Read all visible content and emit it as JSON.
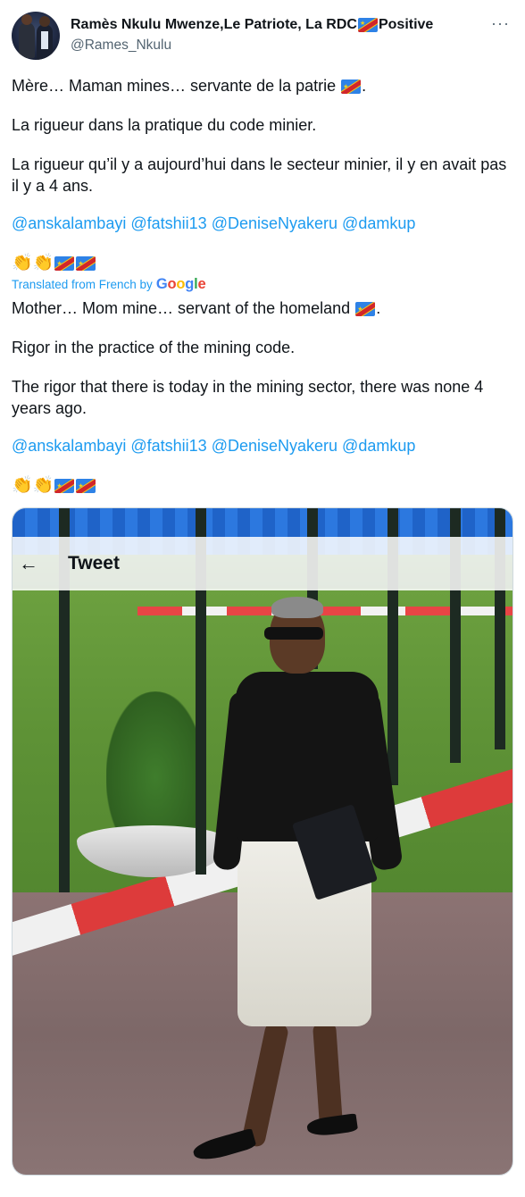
{
  "author": {
    "display_name": "Ramès Nkulu Mwenze,Le Patriote, La RDC",
    "display_name_suffix": "Positive",
    "handle": "@Rames_Nkulu"
  },
  "more_menu": "···",
  "original": {
    "line1": "Mère… Maman mines… servante de la patrie",
    "line1_end": ".",
    "line2": "La rigueur dans la pratique du code minier.",
    "line3": "La rigueur qu’il y a aujourd’hui dans le secteur minier, il y en avait pas il y a 4 ans.",
    "mentions": [
      "@anskalambayi",
      "@fatshii13",
      "@DeniseNyakeru",
      "@damkup"
    ]
  },
  "translation_label": "Translated from French by",
  "google_letters": [
    "G",
    "o",
    "o",
    "g",
    "l",
    "e"
  ],
  "translated": {
    "line1": "Mother… Mom mine… servant of the homeland",
    "line1_end": ".",
    "line2": "Rigor in the practice of the mining code.",
    "line3": "The rigor that there is today in the mining sector, there was none 4 years ago.",
    "mentions": [
      "@anskalambayi",
      "@fatshii13",
      "@DeniseNyakeru",
      "@damkup"
    ]
  },
  "emoji_row": {
    "clap": "👏",
    "flag_icon": "drc-flag-icon"
  },
  "media_screenshot": {
    "back_arrow": "←",
    "title": "Tweet"
  },
  "colors": {
    "mention": "#1d9bf0",
    "text": "#0f1419",
    "secondary": "#536471"
  }
}
